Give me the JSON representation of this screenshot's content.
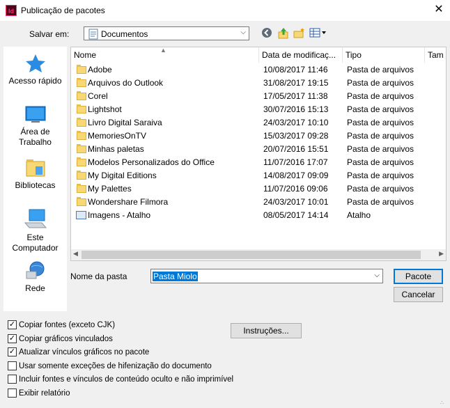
{
  "window": {
    "title": "Publicação de pacotes",
    "app_icon_text": "Id",
    "close_glyph": "✕"
  },
  "savein": {
    "label": "Salvar em:",
    "value": "Documentos"
  },
  "places": [
    {
      "label": "Acesso rápido",
      "icon": "star-icon"
    },
    {
      "label": "Área de Trabalho",
      "icon": "desktop-icon"
    },
    {
      "label": "Bibliotecas",
      "icon": "libraries-icon"
    },
    {
      "label": "Este Computador",
      "icon": "computer-icon"
    },
    {
      "label": "Rede",
      "icon": "network-icon"
    }
  ],
  "columns": {
    "name": "Nome",
    "date": "Data de modificaç...",
    "type": "Tipo",
    "size": "Tam"
  },
  "files": [
    {
      "name": "Adobe",
      "date": "10/08/2017 11:46",
      "type": "Pasta de arquivos",
      "kind": "folder"
    },
    {
      "name": "Arquivos do Outlook",
      "date": "31/08/2017 19:15",
      "type": "Pasta de arquivos",
      "kind": "folder"
    },
    {
      "name": "Corel",
      "date": "17/05/2017 11:38",
      "type": "Pasta de arquivos",
      "kind": "folder"
    },
    {
      "name": "Lightshot",
      "date": "30/07/2016 15:13",
      "type": "Pasta de arquivos",
      "kind": "folder"
    },
    {
      "name": "Livro Digital Saraiva",
      "date": "24/03/2017 10:10",
      "type": "Pasta de arquivos",
      "kind": "folder"
    },
    {
      "name": "MemoriesOnTV",
      "date": "15/03/2017 09:28",
      "type": "Pasta de arquivos",
      "kind": "folder"
    },
    {
      "name": "Minhas paletas",
      "date": "20/07/2016 15:51",
      "type": "Pasta de arquivos",
      "kind": "folder"
    },
    {
      "name": "Modelos Personalizados do Office",
      "date": "11/07/2016 17:07",
      "type": "Pasta de arquivos",
      "kind": "folder"
    },
    {
      "name": "My Digital Editions",
      "date": "14/08/2017 09:09",
      "type": "Pasta de arquivos",
      "kind": "folder"
    },
    {
      "name": "My Palettes",
      "date": "11/07/2016 09:06",
      "type": "Pasta de arquivos",
      "kind": "folder"
    },
    {
      "name": "Wondershare Filmora",
      "date": "24/03/2017 10:01",
      "type": "Pasta de arquivos",
      "kind": "folder"
    },
    {
      "name": "Imagens - Atalho",
      "date": "08/05/2017 14:14",
      "type": "Atalho",
      "kind": "shortcut"
    }
  ],
  "foldername": {
    "label": "Nome da pasta",
    "value": "Pasta Miolo"
  },
  "buttons": {
    "package": "Pacote",
    "cancel": "Cancelar",
    "instructions": "Instruções..."
  },
  "options": [
    {
      "label": "Copiar fontes (exceto CJK)",
      "checked": true
    },
    {
      "label": "Copiar gráficos vinculados",
      "checked": true
    },
    {
      "label": "Atualizar vínculos gráficos no pacote",
      "checked": true
    },
    {
      "label": "Usar somente exceções de hifenização do documento",
      "checked": false
    },
    {
      "label": "Incluir fontes e vínculos de conteúdo oculto e não imprimível",
      "checked": false
    },
    {
      "label": "Exibir relatório",
      "checked": false
    }
  ],
  "colors": {
    "accent": "#0078d7",
    "folder": "#f8d775"
  }
}
